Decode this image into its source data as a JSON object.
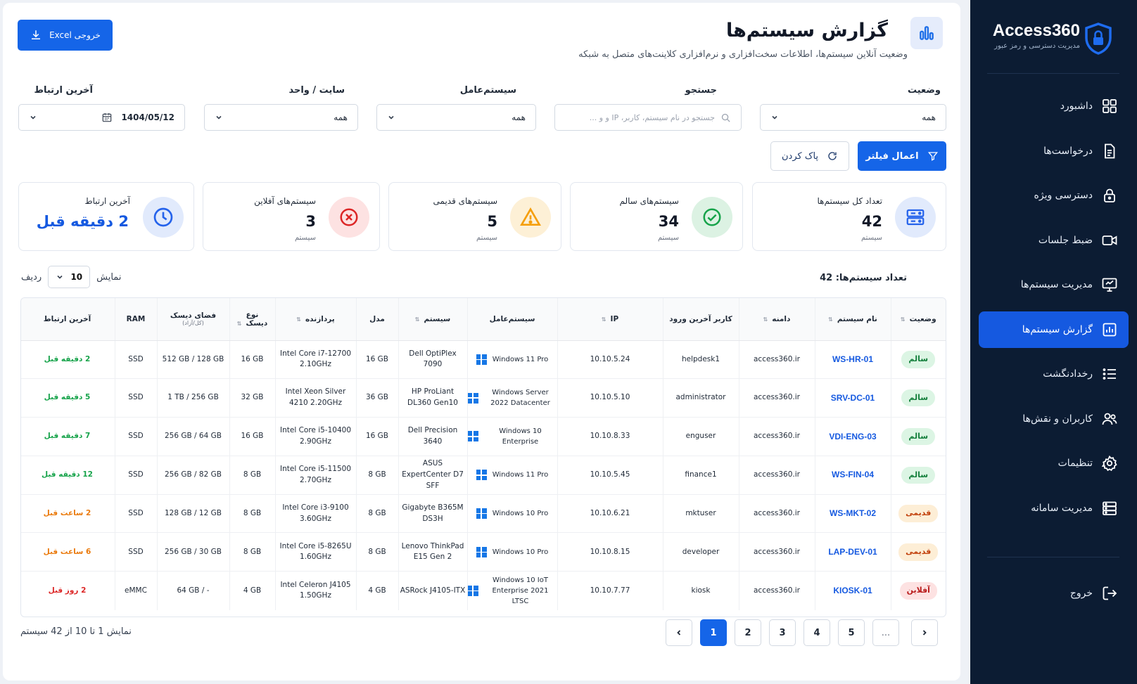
{
  "brand": {
    "name": "Access360",
    "subtitle": "مدیریت دسترسی و رمز عبور"
  },
  "sidebar": {
    "items": [
      {
        "label": "داشبورد",
        "icon": "grid-icon"
      },
      {
        "label": "درخواست‌ها",
        "icon": "document-icon"
      },
      {
        "label": "دسترسی ویژه",
        "icon": "lock-icon"
      },
      {
        "label": "ضبط جلسات",
        "icon": "video-icon"
      },
      {
        "label": "مدیریت سیستم‌ها",
        "icon": "monitor-icon"
      },
      {
        "label": "گزارش سیستم‌ها",
        "icon": "report-icon",
        "active": true
      },
      {
        "label": "رخدادنگشت",
        "icon": "list-icon"
      },
      {
        "label": "کاربران و نقش‌ها",
        "icon": "users-icon"
      },
      {
        "label": "تنظیمات",
        "icon": "gear-icon"
      },
      {
        "label": "مدیریت سامانه",
        "icon": "server-icon"
      }
    ],
    "logout": "خروج"
  },
  "header": {
    "title": "گزارش سیستم‌ها",
    "subtitle": "وضعیت آنلاین سیستم‌ها، اطلاعات سخت‌افزاری و نرم‌افزاری کلاینت‌های متصل به شبکه",
    "excel_button": "خروجی Excel"
  },
  "filters": {
    "status": {
      "label": "وضعیت",
      "value": "همه"
    },
    "search": {
      "label": "جستجو",
      "placeholder": "جستجو در نام سیستم، کاربر، IP و و ..."
    },
    "os": {
      "label": "سیستم‌عامل",
      "value": "همه"
    },
    "site": {
      "label": "سایت / واحد",
      "value": "همه"
    },
    "last_contact": {
      "label": "آخرین ارتباط",
      "value": "1404/05/12"
    },
    "apply": "اعمال فیلتر",
    "clear": "پاک کردن"
  },
  "cards": [
    {
      "label": "تعداد کل سیستم‌ها",
      "value": "42",
      "unit": "سیستم",
      "icon": "server-icon",
      "color": "#2563eb"
    },
    {
      "label": "سیستم‌های سالم",
      "value": "34",
      "unit": "سیستم",
      "icon": "check-circle-icon",
      "color": "#16a34a"
    },
    {
      "label": "سیستم‌های قدیمی",
      "value": "5",
      "unit": "سیستم",
      "icon": "warning-icon",
      "color": "#f59e0b"
    },
    {
      "label": "سیستم‌های آفلاین",
      "value": "3",
      "unit": "سیستم",
      "icon": "x-circle-icon",
      "color": "#dc2626"
    },
    {
      "label": "آخرین ارتباط",
      "value": "2 دقیقه قبل",
      "icon": "clock-icon",
      "color": "#2563eb"
    }
  ],
  "table_meta": {
    "count_label": "تعداد سیستم‌ها: 42",
    "show_label": "نمایش",
    "rows_label": "ردیف",
    "page_size": "10"
  },
  "table": {
    "headers": {
      "status": "وضعیت",
      "name": "نام سیستم",
      "domain": "دامنه",
      "last_user": "کاربر آخرین ورود",
      "ip": "IP",
      "os": "سیستم‌عامل",
      "system": "سیستم",
      "model": "مدل",
      "cpu": "پردازنده",
      "disk_type": "نوع دیسک",
      "disk_space": "فضای دیسک",
      "disk_space_sub": "(کل/آزاد)",
      "ram": "RAM",
      "last_contact": "آخرین ارتباط"
    },
    "rows": [
      {
        "status": "سالم",
        "status_kind": "ok",
        "name": "WS-HR-01",
        "domain": "access360.ir",
        "last_user": "helpdesk1",
        "ip": "10.10.5.24",
        "os": "Windows 11 Pro",
        "system": "Dell OptiPlex 7090",
        "model": "16 GB",
        "cpu": "Intel Core i7-12700 2.10GHz",
        "disk_type": "16 GB",
        "disk_space": "512 GB / 128 GB",
        "ram": "SSD",
        "last_contact": "2 دقیقه قبل",
        "contact_kind": "ok"
      },
      {
        "status": "سالم",
        "status_kind": "ok",
        "name": "SRV-DC-01",
        "domain": "access360.ir",
        "last_user": "administrator",
        "ip": "10.10.5.10",
        "os": "Windows Server 2022 Datacenter",
        "system": "HP ProLiant DL360 Gen10",
        "model": "36 GB",
        "cpu": "Intel Xeon Silver 4210 2.20GHz",
        "disk_type": "32 GB",
        "disk_space": "1 TB / 256 GB",
        "ram": "SSD",
        "last_contact": "5 دقیقه قبل",
        "contact_kind": "ok"
      },
      {
        "status": "سالم",
        "status_kind": "ok",
        "name": "VDI-ENG-03",
        "domain": "access360.ir",
        "last_user": "enguser",
        "ip": "10.10.8.33",
        "os": "Windows 10 Enterprise",
        "system": "Dell Precision 3640",
        "model": "16 GB",
        "cpu": "Intel Core i5-10400 2.90GHz",
        "disk_type": "16 GB",
        "disk_space": "256 GB / 64 GB",
        "ram": "SSD",
        "last_contact": "7 دقیقه قبل",
        "contact_kind": "ok"
      },
      {
        "status": "سالم",
        "status_kind": "ok",
        "name": "WS-FIN-04",
        "domain": "access360.ir",
        "last_user": "finance1",
        "ip": "10.10.5.45",
        "os": "Windows 11 Pro",
        "system": "ASUS ExpertCenter D7 SFF",
        "model": "8 GB",
        "cpu": "Intel Core i5-11500 2.70GHz",
        "disk_type": "8 GB",
        "disk_space": "256 GB / 82 GB",
        "ram": "SSD",
        "last_contact": "12 دقیقه قبل",
        "contact_kind": "ok"
      },
      {
        "status": "قدیمی",
        "status_kind": "old",
        "name": "WS-MKT-02",
        "domain": "access360.ir",
        "last_user": "mktuser",
        "ip": "10.10.6.21",
        "os": "Windows 10 Pro",
        "system": "Gigabyte B365M DS3H",
        "model": "8 GB",
        "cpu": "Intel Core i3-9100 3.60GHz",
        "disk_type": "8 GB",
        "disk_space": "128 GB / 12 GB",
        "ram": "SSD",
        "last_contact": "2 ساعت قبل",
        "contact_kind": "old"
      },
      {
        "status": "قدیمی",
        "status_kind": "old",
        "name": "LAP-DEV-01",
        "domain": "access360.ir",
        "last_user": "developer",
        "ip": "10.10.8.15",
        "os": "Windows 10 Pro",
        "system": "Lenovo ThinkPad E15 Gen 2",
        "model": "8 GB",
        "cpu": "Intel Core i5-8265U 1.60GHz",
        "disk_type": "8 GB",
        "disk_space": "256 GB / 30 GB",
        "ram": "SSD",
        "last_contact": "6 ساعت قبل",
        "contact_kind": "old"
      },
      {
        "status": "آفلاین",
        "status_kind": "off",
        "name": "KIOSK-01",
        "domain": "access360.ir",
        "last_user": "kiosk",
        "ip": "10.10.7.77",
        "os": "Windows 10 IoT Enterprise 2021 LTSC",
        "system": "ASRock J4105-ITX",
        "model": "4 GB",
        "cpu": "Intel Celeron J4105 1.50GHz",
        "disk_type": "4 GB",
        "disk_space": "64 GB / -",
        "ram": "eMMC",
        "last_contact": "2 روز قبل",
        "contact_kind": "off"
      }
    ]
  },
  "pagination": {
    "summary": "نمایش 1 تا 10 از 42 سیستم",
    "pages": [
      "1",
      "2",
      "3",
      "4",
      "5",
      "..."
    ],
    "active": "1"
  },
  "colors": {
    "accent": "#1565e8",
    "sidebar_bg": "#0c1c33",
    "ok": "#16a34a",
    "old": "#ea7a0c",
    "off": "#dc2626"
  }
}
